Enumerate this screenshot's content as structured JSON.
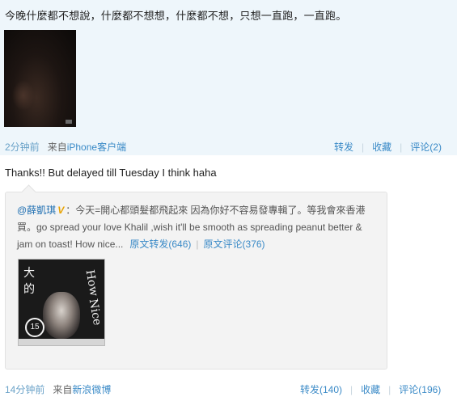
{
  "post1": {
    "text": "今晚什麼都不想說，什麼都不想想，什麼都不想，只想一直跑，一直跑。",
    "time": "2分钟前",
    "from_prefix": "来自",
    "source": "iPhone客户端",
    "actions": {
      "forward": "转发",
      "favorite": "收藏",
      "comment": "评论(2)"
    },
    "thumb_icon": "photo-thumbnail"
  },
  "post2": {
    "text": "Thanks!! But delayed till Tuesday I think haha",
    "quote": {
      "user": "@薛凱琪",
      "badge": "V",
      "text": "：今天=開心都頭髮都飛起來  因為你好不容易發專輯了。等我會來香港買。go spread your love Khalil ,wish it'll be smooth as spreading peanut better & jam on toast! How nice...",
      "orig_forward": "原文转发(646)",
      "orig_comment": "原文评论(376)",
      "thumb_icon": "photo-thumbnail"
    },
    "time": "14分钟前",
    "from_prefix": "来自",
    "source": "新浪微博",
    "actions": {
      "forward": "转发(140)",
      "favorite": "收藏",
      "comment": "评论(196)"
    }
  },
  "colors": {
    "post_highlight_bg": "#eef6fb",
    "link": "#3a8ac7",
    "time": "#6aa2c8",
    "verified_badge": "#e8a200"
  }
}
